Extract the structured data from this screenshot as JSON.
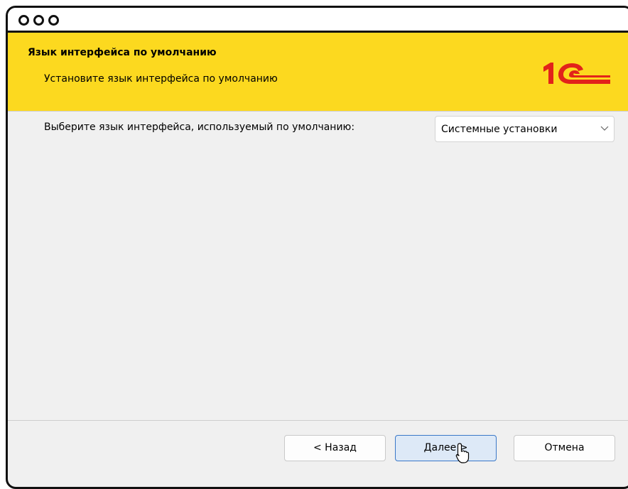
{
  "header": {
    "title": "Язык интерфейса по умолчанию",
    "subtitle": "Установите язык интерфейса по умолчанию",
    "logo": "1С"
  },
  "content": {
    "language_label": "Выберите язык интерфейса, используемый по умолчанию:",
    "language_select": {
      "selected": "Системные установки",
      "icon": "chevron-down-icon"
    }
  },
  "footer": {
    "back_label": "< Назад",
    "next_label": "Далее >",
    "cancel_label": "Отмена"
  },
  "colors": {
    "header_background": "#fcd91f",
    "logo_red": "#e2231a",
    "primary_button_border": "#3a78c8",
    "primary_button_background": "#dde9f7"
  }
}
